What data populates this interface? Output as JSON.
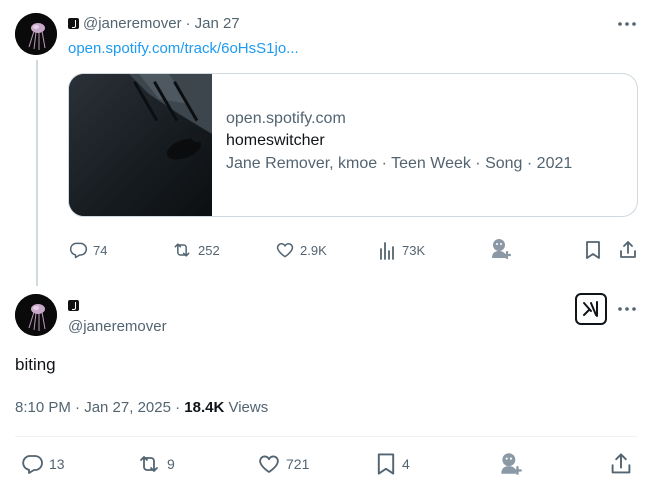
{
  "tweet1": {
    "handle": "@janeremover",
    "separator": "·",
    "date": "Jan 27",
    "link": "open.spotify.com/track/6oHsS1jo...",
    "card": {
      "domain": "open.spotify.com",
      "title": "homeswitcher",
      "description": "Jane Remover, kmoe · Teen Week · Song · 2021"
    },
    "actions": {
      "replies": "74",
      "reposts": "252",
      "likes": "2.9K",
      "views": "73K"
    }
  },
  "tweet2": {
    "handle": "@janeremover",
    "text": "biting",
    "timestamp": "8:10 PM · Jan 27, 2025 · ",
    "views_count": "18.4K",
    "views_label": "Views",
    "actions": {
      "replies": "13",
      "reposts": "9",
      "likes": "721",
      "bookmarks": "4"
    }
  },
  "icons": {
    "more": "more-icon",
    "reply": "reply-icon",
    "repost": "repost-icon",
    "like": "heart-icon",
    "views": "views-icon",
    "grok": "grok-icon",
    "bookmark": "bookmark-icon",
    "share": "share-icon",
    "ai-person": "ai-person-icon"
  },
  "colors": {
    "link": "#1d9bf0",
    "secondary": "#536471",
    "border": "#cfd9de"
  }
}
